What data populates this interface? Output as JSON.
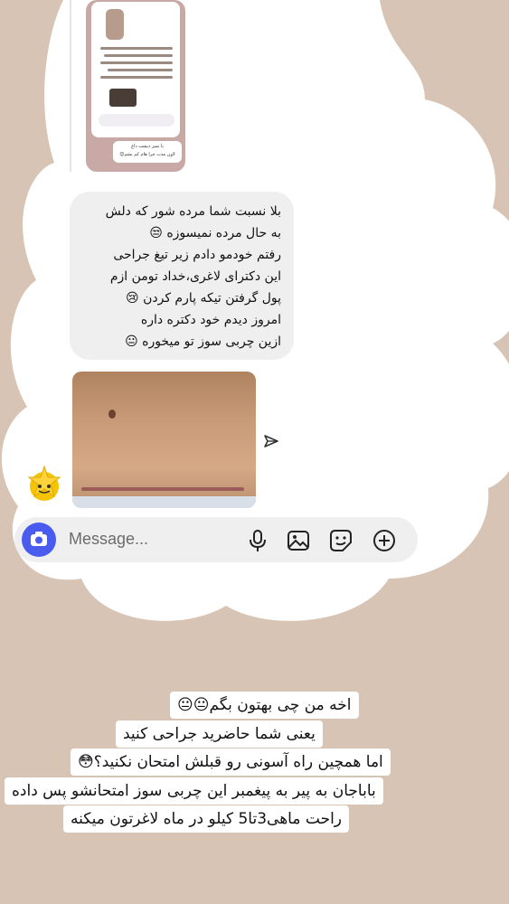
{
  "thumbnail": {
    "bubble_line_1": "با تمیز دیشب داغ",
    "bubble_line_2": "لاون مدت چرا هام کم بشم😊"
  },
  "chat": {
    "bubble_lines": [
      "بلا نسبت شما مرده شور که دلش",
      "به حال مرده نمیسوزه 😒",
      "رفتم خودمو دادم زیر تیغ جراحی",
      "این دکترای لاغری،خداد تومن ازم",
      "پول گرفتن تیکه پارم کردن 😢",
      "امروز دیدم خود دکتره داره",
      "ازین چربی سوز تو میخوره 😐"
    ],
    "sticker": "🌟",
    "composer_placeholder": "Message..."
  },
  "caption_lines": [
    "اخه من چی بهتون بگم😐😐",
    "یعنی شما حاضرید جراحی کنید",
    "اما همچین راه آسونی رو قبلش امتحان نکنید؟😳",
    "باباجان به پیر به پیغمبر این چربی سوز امتحانشو پس داده",
    "راحت ماهی3تا5 کیلو در ماه  لاغرتون میکنه"
  ],
  "icons": {
    "camera": "camera-icon",
    "mic": "microphone-icon",
    "gallery": "image-icon",
    "sticker": "sticker-icon",
    "add": "plus-circle-icon",
    "share": "send-icon"
  },
  "colors": {
    "background": "#d8c4b4",
    "cloud": "#ffffff",
    "bubble": "#efefef",
    "camera_button": "#4a5bf0"
  }
}
